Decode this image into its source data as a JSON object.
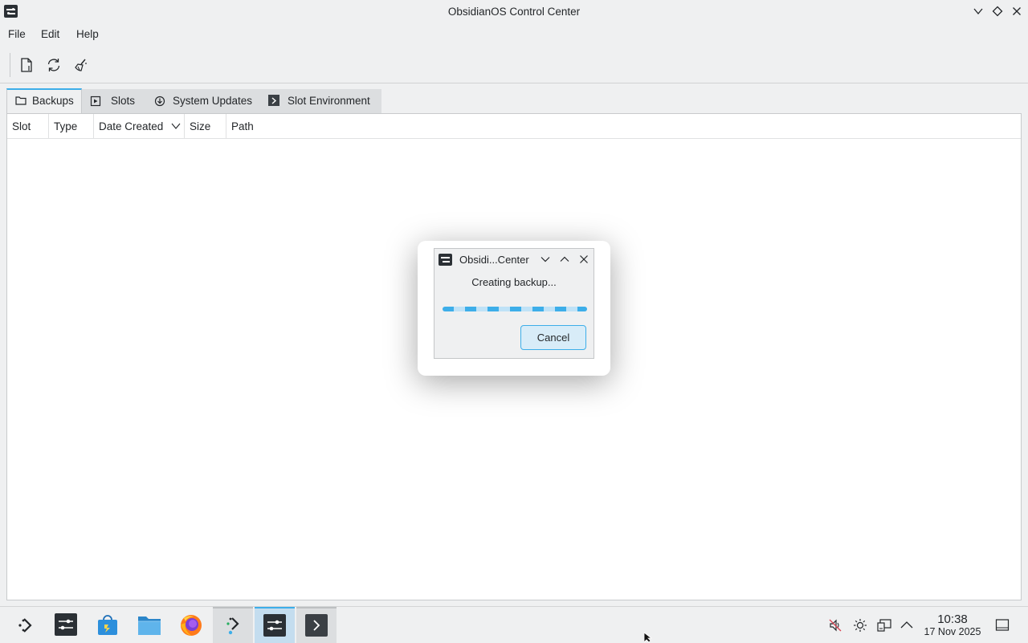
{
  "window": {
    "title": "ObsidianOS Control Center",
    "icon": "control-center-icon"
  },
  "menu": {
    "items": [
      "File",
      "Edit",
      "Help"
    ]
  },
  "toolbar": {
    "buttons": [
      "new-document-icon",
      "refresh-icon",
      "clean-icon"
    ]
  },
  "tabs": [
    {
      "label": "Backups",
      "icon": "folder-icon",
      "active": true
    },
    {
      "label": "Slots",
      "icon": "media-icon",
      "active": false
    },
    {
      "label": "System Updates",
      "icon": "download-icon",
      "active": false
    },
    {
      "label": "Slot Environment",
      "icon": "terminal-icon",
      "active": false
    }
  ],
  "table": {
    "columns": [
      "Slot",
      "Type",
      "Date Created",
      "Size",
      "Path"
    ],
    "sort_column": "Date Created",
    "rows": []
  },
  "dialog": {
    "title": "Obsidi...Center",
    "message": "Creating backup...",
    "progress": "indeterminate",
    "cancel_label": "Cancel"
  },
  "taskbar": {
    "apps": [
      "app-launcher-icon",
      "control-center-icon",
      "software-store-icon",
      "file-manager-icon",
      "firefox-icon",
      "installer-icon",
      "control-center-icon",
      "terminal-icon"
    ],
    "tray": [
      "muted-audio-icon",
      "brightness-icon",
      "network-icon",
      "tray-expand-icon"
    ],
    "clock_time": "10:38",
    "clock_date": "17 Nov 2025"
  },
  "colors": {
    "accent": "#3daee9",
    "background": "#eff0f1",
    "text": "#232629"
  }
}
